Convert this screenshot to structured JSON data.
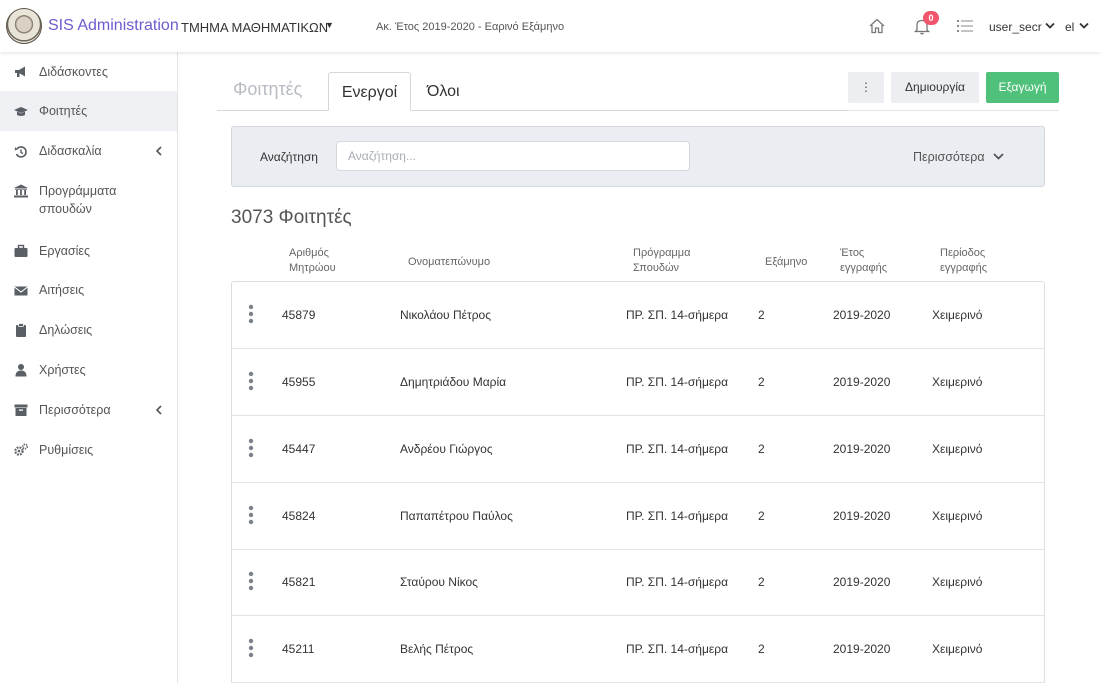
{
  "header": {
    "app_title": "SIS Administration",
    "department": "ΤΜΗΜΑ ΜΑΘΗΜΑΤΙΚΩΝ",
    "academic_year": "Ακ. Έτος 2019-2020 - Εαρινό Εξάμηνο",
    "notification_count": "0",
    "user": "user_secr",
    "language": "el"
  },
  "sidebar": {
    "items": [
      {
        "label": "Διδάσκοντες",
        "icon": "megaphone-icon"
      },
      {
        "label": "Φοιτητές",
        "icon": "graduation-cap-icon",
        "active": true
      },
      {
        "label": "Διδασκαλία",
        "icon": "history-icon",
        "expandable": true
      },
      {
        "label": "Προγράμματα σπουδών",
        "icon": "institution-icon"
      },
      {
        "label": "Εργασίες",
        "icon": "briefcase-icon"
      },
      {
        "label": "Αιτήσεις",
        "icon": "envelope-icon"
      },
      {
        "label": "Δηλώσεις",
        "icon": "clipboard-icon"
      },
      {
        "label": "Χρήστες",
        "icon": "user-icon"
      },
      {
        "label": "Περισσότερα",
        "icon": "archive-icon",
        "expandable": true
      },
      {
        "label": "Ρυθμίσεις",
        "icon": "cogs-icon"
      }
    ]
  },
  "main": {
    "section_title": "Φοιτητές",
    "tabs": [
      {
        "label": "Ενεργοί",
        "active": true
      },
      {
        "label": "Όλοι",
        "active": false
      }
    ],
    "more_button": "⋮",
    "create_button": "Δημιουργία",
    "export_button": "Εξαγωγή",
    "search": {
      "label": "Αναζήτηση",
      "placeholder": "Αναζήτηση...",
      "value": "",
      "more_filters": "Περισσότερα"
    },
    "count_title": "3073 Φοιτητές",
    "columns": [
      "Αριθμός Μητρώου",
      "Ονοματεπώνυμο",
      "Πρόγραμμα Σπουδών",
      "Εξάμηνο",
      "Έτος εγγραφής",
      "Περίοδος εγγραφής"
    ],
    "rows": [
      {
        "id": "45879",
        "name": "Νικολάου Πέτρος",
        "program": "ΠΡ. ΣΠ. 14-σήμερα",
        "semester": "2",
        "year": "2019-2020",
        "period": "Χειμερινό"
      },
      {
        "id": "45955",
        "name": "Δημητριάδου Μαρία",
        "program": "ΠΡ. ΣΠ. 14-σήμερα",
        "semester": "2",
        "year": "2019-2020",
        "period": "Χειμερινό"
      },
      {
        "id": "45447",
        "name": "Ανδρέου Γιώργος",
        "program": "ΠΡ. ΣΠ. 14-σήμερα",
        "semester": "2",
        "year": "2019-2020",
        "period": "Χειμερινό"
      },
      {
        "id": "45824",
        "name": "Παπαπέτρου Παύλος",
        "program": "ΠΡ. ΣΠ. 14-σήμερα",
        "semester": "2",
        "year": "2019-2020",
        "period": "Χειμερινό"
      },
      {
        "id": "45821",
        "name": "Σταύρου Νίκος",
        "program": "ΠΡ. ΣΠ. 14-σήμερα",
        "semester": "2",
        "year": "2019-2020",
        "period": "Χειμερινό"
      },
      {
        "id": "45211",
        "name": "Βελής Πέτρος",
        "program": "ΠΡ. ΣΠ. 14-σήμερα",
        "semester": "2",
        "year": "2019-2020",
        "period": "Χειμερινό"
      }
    ]
  },
  "colors": {
    "brand": "#6d5bd0",
    "export": "#50c17a",
    "badge": "#f1556c"
  }
}
